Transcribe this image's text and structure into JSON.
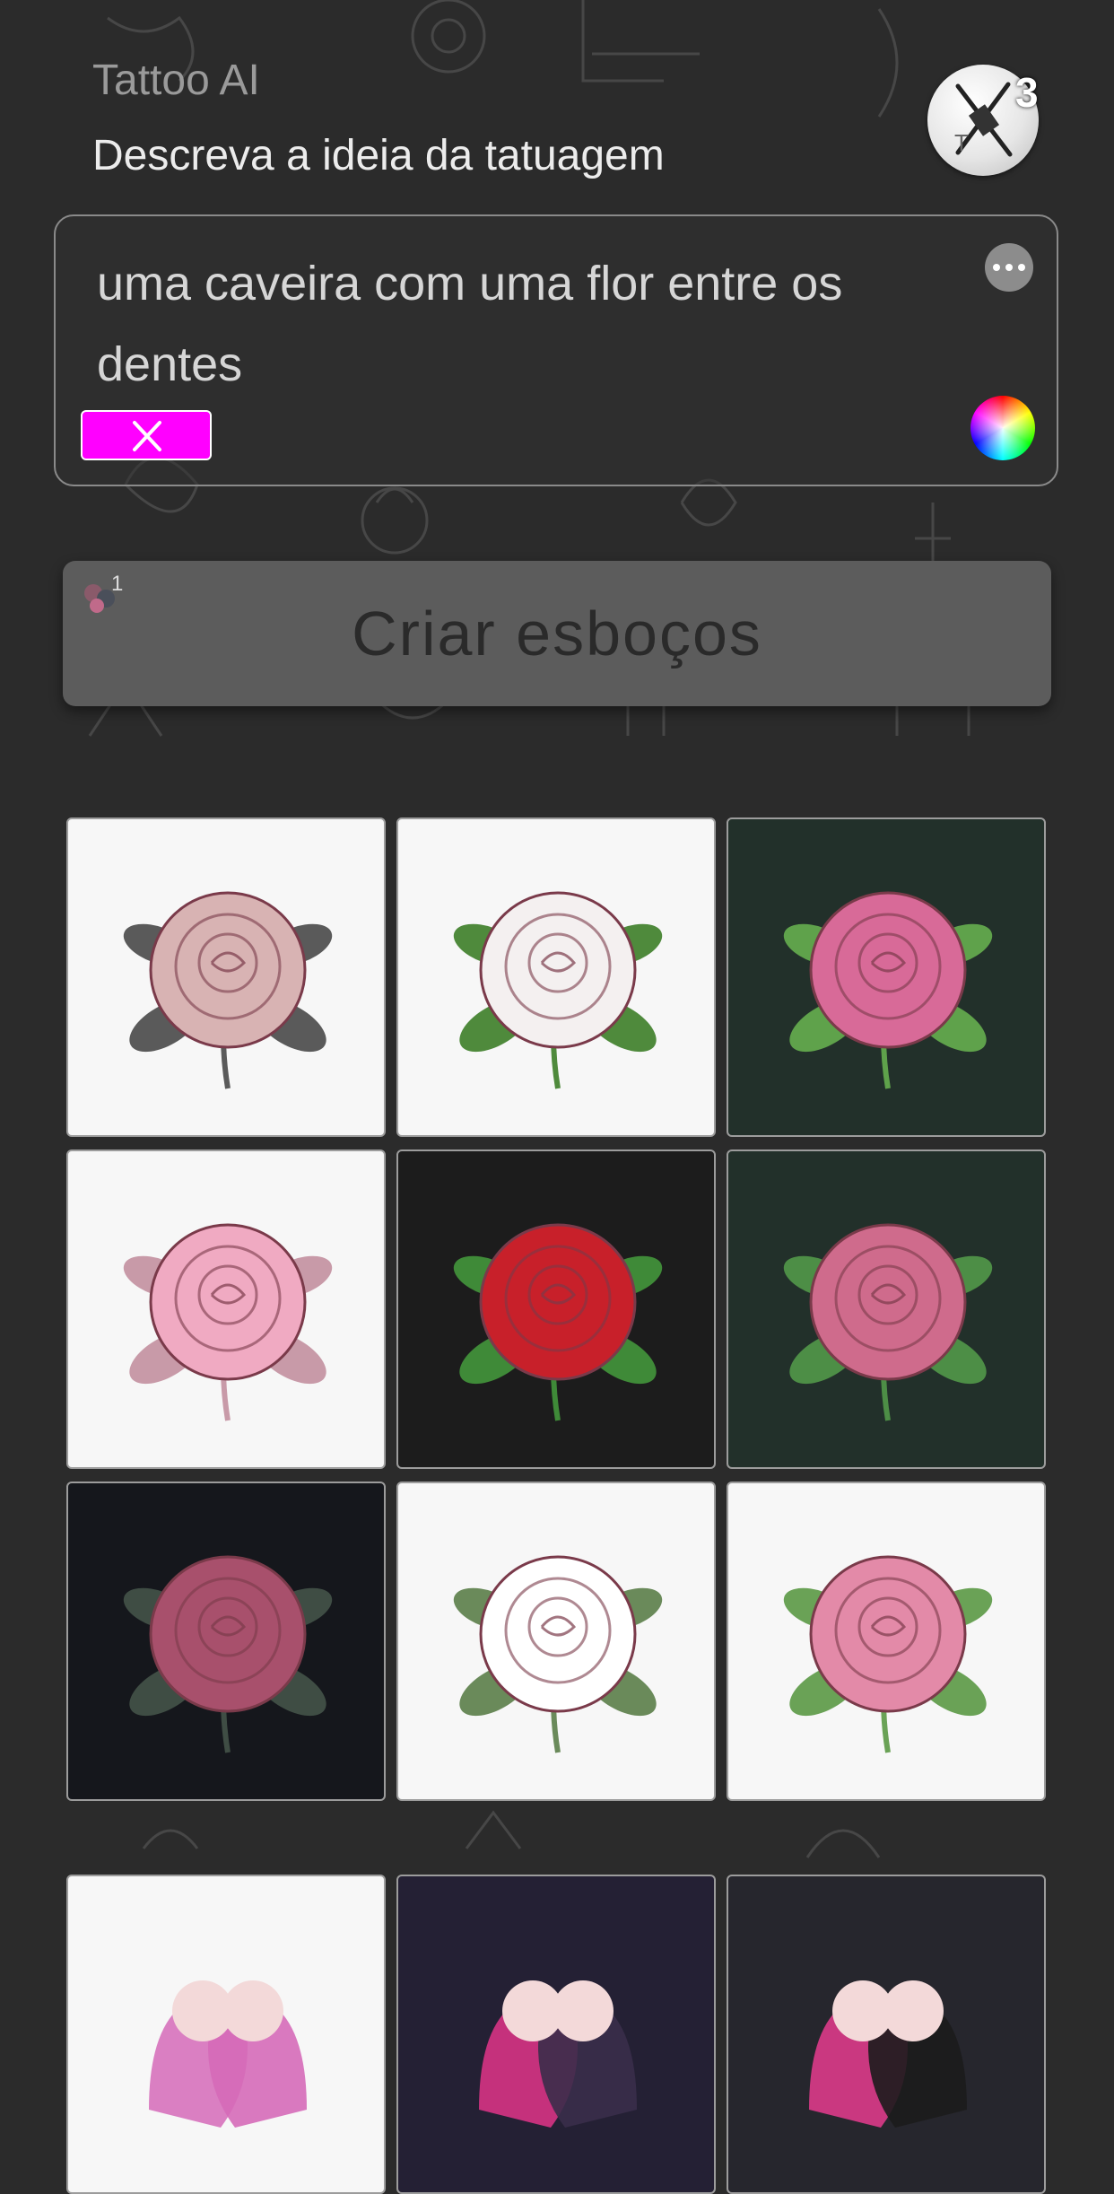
{
  "header": {
    "app_name": "Tattoo AI",
    "prompt_title": "Descreva a ideia da tatuagem",
    "credits": "3"
  },
  "prompt": {
    "text": "uma caveira com uma flor entre os dentes"
  },
  "create_button": {
    "label": "Criar esboços",
    "badge_count": "1"
  },
  "colors": {
    "background": "#2b2b2b",
    "clear_button": "#ff00ff",
    "create_button": "#5c5c5c"
  },
  "gallery": [
    {
      "name": "pale-pink-rose-sketch",
      "background": "#f7f7f7",
      "rose": "#d8b3b3",
      "leaf": "#5a5a5a"
    },
    {
      "name": "white-red-rose-green-leaves",
      "background": "#f7f7f7",
      "rose": "#f4f0f0",
      "leaf": "#4f8a3c"
    },
    {
      "name": "pink-rose-on-dark-green",
      "background": "#22302a",
      "rose": "#d86a98",
      "leaf": "#5fa24b"
    },
    {
      "name": "light-pink-rose-watercolor",
      "background": "#f7f7f7",
      "rose": "#f0aac2",
      "leaf": "#c89aa8"
    },
    {
      "name": "red-rose-on-black",
      "background": "#1c1c1c",
      "rose": "#c8202a",
      "leaf": "#3f8a38"
    },
    {
      "name": "pink-rose-on-green",
      "background": "#22302a",
      "rose": "#cf6b8c",
      "leaf": "#4d8e46"
    },
    {
      "name": "dark-pink-rose-on-black",
      "background": "#15171c",
      "rose": "#a8506c",
      "leaf": "#3f4d44"
    },
    {
      "name": "white-rose-line-art",
      "background": "#f7f7f7",
      "rose": "#ffffff",
      "leaf": "#6a8a5a"
    },
    {
      "name": "pink-rose-on-white",
      "background": "#f7f7f7",
      "rose": "#e38aa8",
      "leaf": "#6aa256"
    },
    {
      "name": "couple-pink-sketch",
      "background": "#f7f7f7",
      "rose": "#d56ab8",
      "leaf": "#d56ab8"
    },
    {
      "name": "couple-pink-heart",
      "background": "#242034",
      "rose": "#e2358a",
      "leaf": "#3a2d4a"
    },
    {
      "name": "couple-dark-pink",
      "background": "#26262d",
      "rose": "#e73c8f",
      "leaf": "#1c1c1c"
    }
  ]
}
